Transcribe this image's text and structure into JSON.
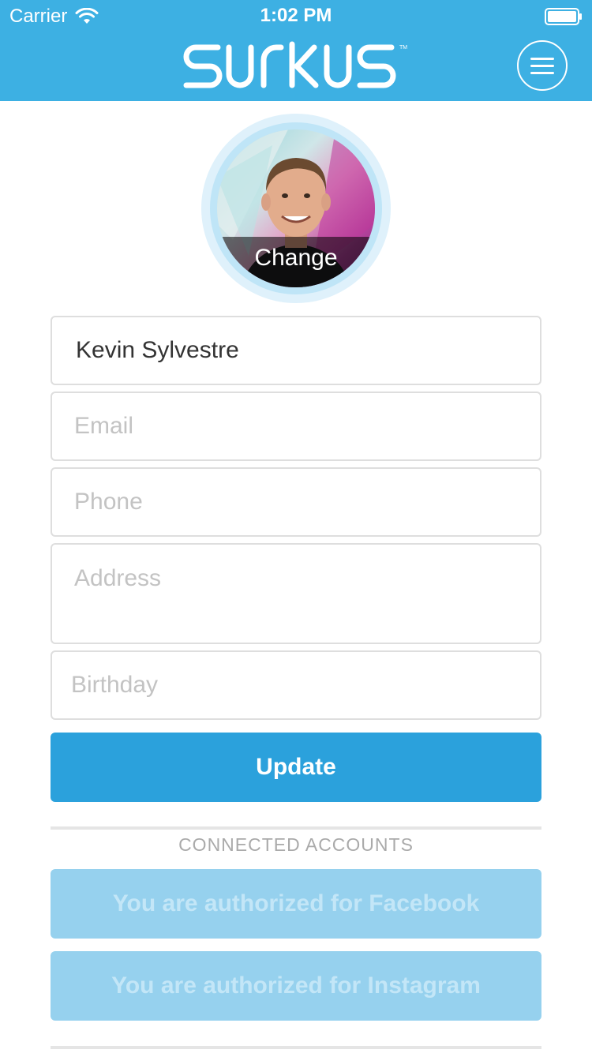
{
  "status_bar": {
    "carrier": "Carrier",
    "time": "1:02 PM"
  },
  "header": {
    "logo_text": "SURKUS",
    "logo_icon": "surkus-logo",
    "menu_icon": "hamburger-menu-icon",
    "background_color": "#3db0e3"
  },
  "profile": {
    "avatar_icon": "profile-photo",
    "change_label": "Change"
  },
  "form": {
    "name_value": "Kevin Sylvestre",
    "email_placeholder": "Email",
    "phone_placeholder": "Phone",
    "address_placeholder": "Address",
    "birthday_placeholder": "Birthday",
    "update_label": "Update",
    "update_color": "#2ba1dc"
  },
  "connected_accounts": {
    "title": "CONNECTED ACCOUNTS",
    "facebook_label": "You are authorized for Facebook",
    "instagram_label": "You are authorized for Instagram",
    "button_color": "#96d1ee"
  }
}
